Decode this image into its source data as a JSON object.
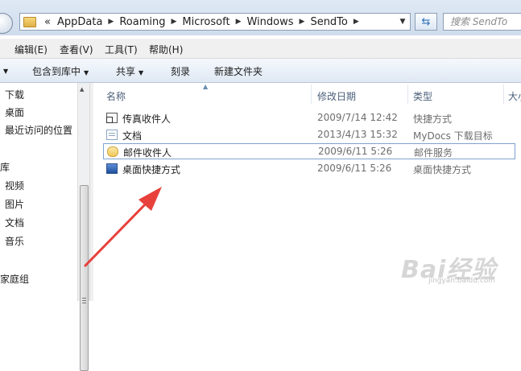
{
  "address_bar": {
    "overflow": "«",
    "crumbs": [
      "AppData",
      "Roaming",
      "Microsoft",
      "Windows",
      "SendTo"
    ],
    "search_placeholder": "搜索 SendTo"
  },
  "menu": [
    "编辑(E)",
    "查看(V)",
    "工具(T)",
    "帮助(H)"
  ],
  "toolbar": {
    "include_library": "包含到库中",
    "share": "共享",
    "burn": "刻录",
    "new_folder": "新建文件夹"
  },
  "nav_pane": {
    "items": [
      "下载",
      "桌面",
      "最近访问的位置",
      "库",
      "视频",
      "图片",
      "文档",
      "音乐",
      "家庭组"
    ]
  },
  "columns": {
    "name": "名称",
    "date": "修改日期",
    "type": "类型",
    "size": "大小"
  },
  "files": [
    {
      "name": "传真收件人",
      "date": "2009/7/14 12:42",
      "type": "快捷方式",
      "icon": "fax-shortcut-icon"
    },
    {
      "name": "文档",
      "date": "2013/4/13 15:32",
      "type": "MyDocs 下载目标",
      "icon": "document-icon"
    },
    {
      "name": "邮件收件人",
      "date": "2009/6/11 5:26",
      "type": "邮件服务",
      "icon": "mail-recipient-icon"
    },
    {
      "name": "桌面快捷方式",
      "date": "2009/6/11 5:26",
      "type": "桌面快捷方式",
      "icon": "desktop-shortcut-icon"
    }
  ],
  "watermark": {
    "logo": "Bai经验",
    "url": "jingyan.baidu.com"
  },
  "colors": {
    "annotation_arrow": "#e8413c",
    "selection_border": "#7da2ce",
    "header_text": "#4c607a"
  }
}
